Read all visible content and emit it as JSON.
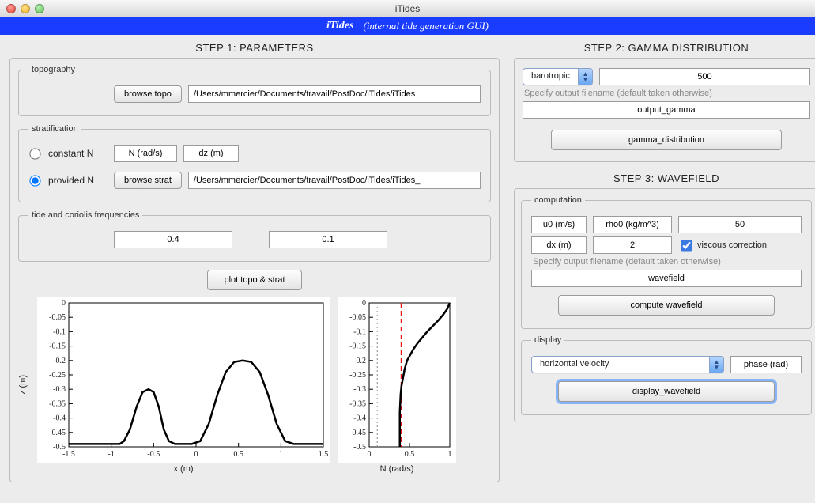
{
  "window": {
    "title": "iTides"
  },
  "banner": {
    "title": "iTides",
    "subtitle": "(internal tide generation GUI)"
  },
  "step1": {
    "heading": "STEP 1: PARAMETERS",
    "topography": {
      "legend": "topography",
      "browse_label": "browse topo",
      "path": "/Users/mmercier/Documents/travail/PostDoc/iTides/iTides"
    },
    "stratification": {
      "legend": "stratification",
      "constant_label": "constant N",
      "provided_label": "provided N",
      "selected": "provided",
      "n_placeholder": "N (rad/s)",
      "dz_placeholder": "dz (m)",
      "browse_label": "browse strat",
      "path": "/Users/mmercier/Documents/travail/PostDoc/iTides/iTides_"
    },
    "tide": {
      "legend": "tide and coriolis frequencies",
      "omega": "0.4",
      "f": "0.1"
    },
    "plot_button": "plot topo & strat",
    "zlabel": "z (m)",
    "xlabel_left": "x (m)",
    "xlabel_right": "N (rad/s)"
  },
  "step2": {
    "heading": "STEP 2: GAMMA DISTRIBUTION",
    "select_value": "barotropic",
    "num": "500",
    "hint": "Specify output filename (default taken otherwise)",
    "filename": "output_gamma",
    "button": "gamma_distribution"
  },
  "step3": {
    "heading": "STEP 3: WAVEFIELD",
    "computation": {
      "legend": "computation",
      "u0_placeholder": "u0 (m/s)",
      "rho0_placeholder": "rho0 (kg/m^3)",
      "rho0_extra": "50",
      "dx_placeholder": "dx (m)",
      "dx_extra": "2",
      "viscous_label": "viscous correction",
      "viscous_checked": true,
      "hint": "Specify output filename (default taken otherwise)",
      "filename": "wavefield",
      "button": "compute wavefield"
    },
    "display": {
      "legend": "display",
      "select_value": "horizontal velocity",
      "phase_placeholder": "phase (rad)",
      "button": "display_wavefield"
    }
  },
  "chart_data": [
    {
      "type": "line",
      "title": "",
      "xlabel": "x (m)",
      "ylabel": "z (m)",
      "xlim": [
        -1.5,
        1.5
      ],
      "ylim": [
        -0.5,
        0
      ],
      "xticks": [
        -1.5,
        -1,
        -0.5,
        0,
        0.5,
        1,
        1.5
      ],
      "yticks": [
        0,
        -0.05,
        -0.1,
        -0.15,
        -0.2,
        -0.25,
        -0.3,
        -0.35,
        -0.4,
        -0.45,
        -0.5
      ],
      "series": [
        {
          "name": "topography",
          "x": [
            -1.5,
            -1.2,
            -1.0,
            -0.9,
            -0.85,
            -0.78,
            -0.7,
            -0.63,
            -0.56,
            -0.5,
            -0.44,
            -0.38,
            -0.32,
            -0.25,
            -0.15,
            -0.05,
            0.05,
            0.15,
            0.25,
            0.35,
            0.45,
            0.55,
            0.65,
            0.75,
            0.85,
            0.95,
            1.05,
            1.15,
            1.3,
            1.5
          ],
          "y": [
            -0.49,
            -0.49,
            -0.49,
            -0.49,
            -0.48,
            -0.44,
            -0.36,
            -0.31,
            -0.3,
            -0.31,
            -0.36,
            -0.44,
            -0.48,
            -0.49,
            -0.49,
            -0.49,
            -0.48,
            -0.42,
            -0.32,
            -0.24,
            -0.205,
            -0.2,
            -0.205,
            -0.24,
            -0.32,
            -0.42,
            -0.48,
            -0.49,
            -0.49,
            -0.49
          ]
        }
      ]
    },
    {
      "type": "line",
      "title": "",
      "xlabel": "N (rad/s)",
      "ylabel": "z (m)",
      "xlim": [
        0,
        1
      ],
      "ylim": [
        -0.5,
        0
      ],
      "xticks": [
        0,
        0.5,
        1
      ],
      "yticks": [
        0,
        -0.05,
        -0.1,
        -0.15,
        -0.2,
        -0.25,
        -0.3,
        -0.35,
        -0.4,
        -0.45,
        -0.5
      ],
      "vlines": [
        {
          "x": 0.1,
          "style": "dot",
          "color": "#888"
        },
        {
          "x": 0.4,
          "style": "dash",
          "color": "#e11"
        }
      ],
      "series": [
        {
          "name": "N-profile",
          "x": [
            1.0,
            0.97,
            0.92,
            0.86,
            0.79,
            0.72,
            0.66,
            0.6,
            0.55,
            0.51,
            0.47,
            0.44,
            0.42,
            0.4,
            0.39,
            0.385,
            0.38,
            0.38,
            0.38,
            0.38,
            0.38
          ],
          "y": [
            0.0,
            -0.02,
            -0.04,
            -0.06,
            -0.08,
            -0.1,
            -0.12,
            -0.14,
            -0.16,
            -0.18,
            -0.2,
            -0.23,
            -0.26,
            -0.29,
            -0.32,
            -0.35,
            -0.38,
            -0.41,
            -0.44,
            -0.47,
            -0.5
          ]
        }
      ]
    }
  ]
}
